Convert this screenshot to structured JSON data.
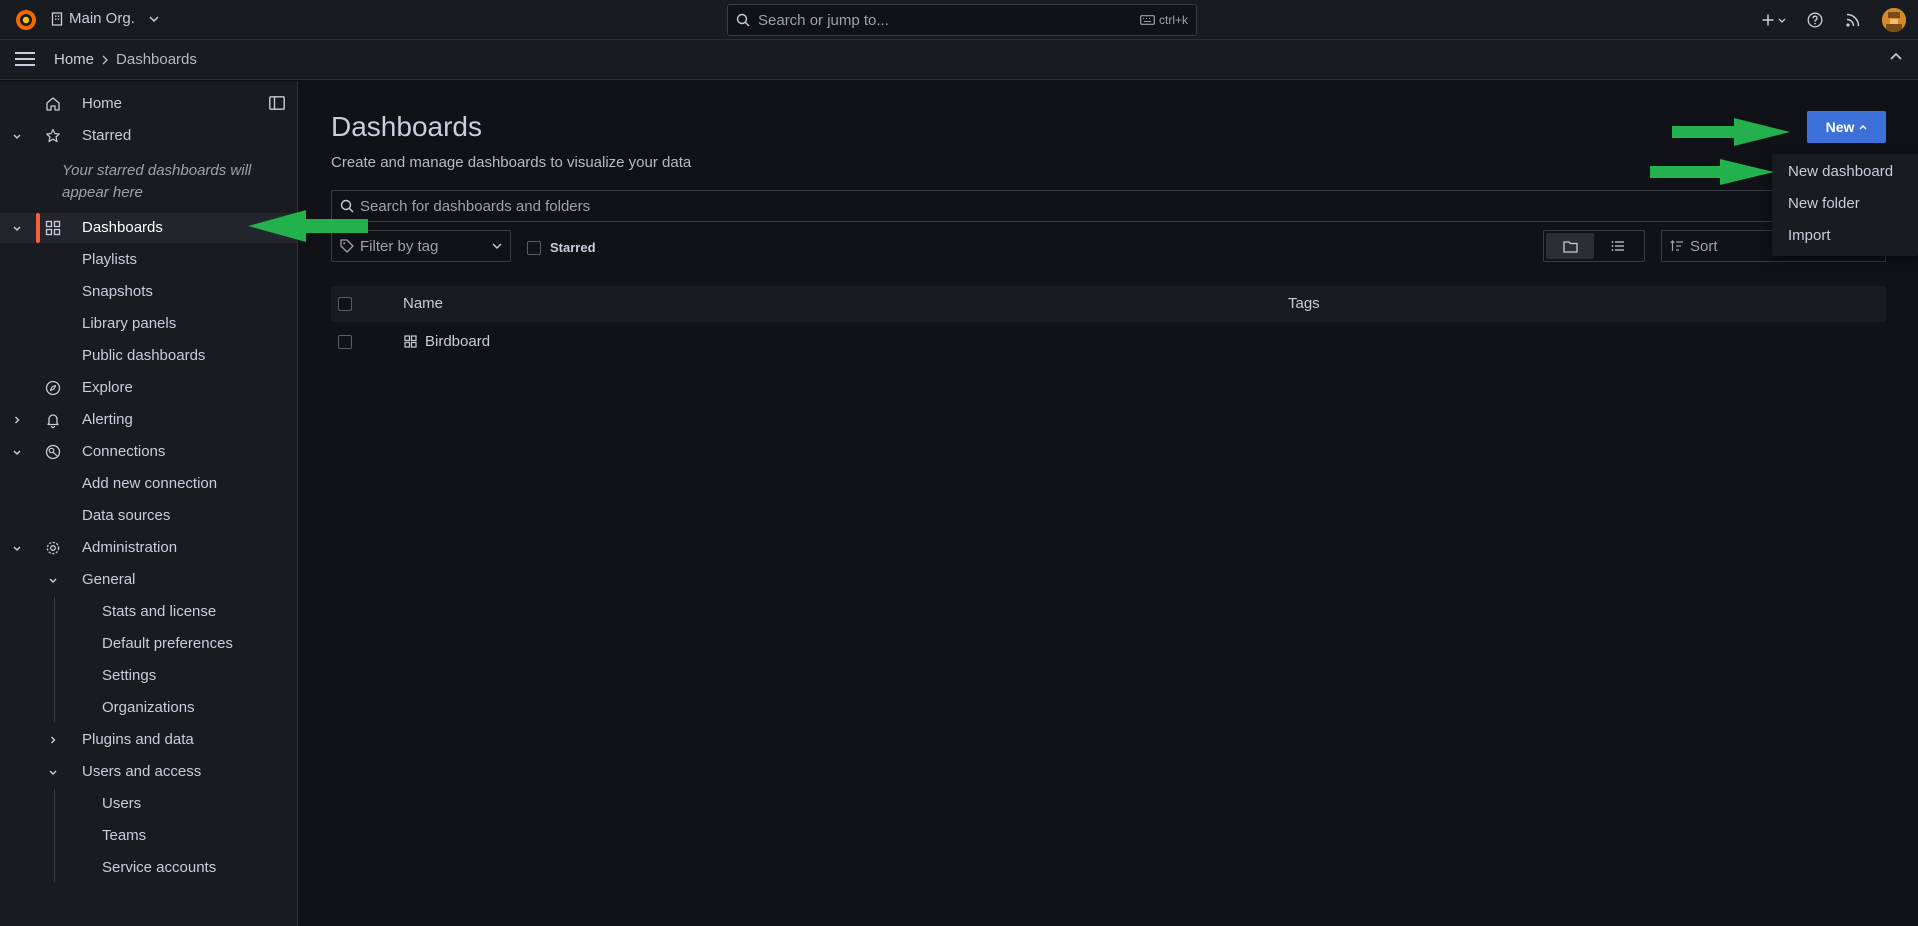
{
  "topbar": {
    "org_name": "Main Org.",
    "search_placeholder": "Search or jump to...",
    "search_shortcut": "ctrl+k"
  },
  "breadcrumb": {
    "home": "Home",
    "current": "Dashboards"
  },
  "sidebar": {
    "home": "Home",
    "starred": "Starred",
    "starred_empty": "Your starred dashboards will appear here",
    "dashboards": "Dashboards",
    "playlists": "Playlists",
    "snapshots": "Snapshots",
    "library_panels": "Library panels",
    "public_dashboards": "Public dashboards",
    "explore": "Explore",
    "alerting": "Alerting",
    "connections": "Connections",
    "add_new_connection": "Add new connection",
    "data_sources": "Data sources",
    "administration": "Administration",
    "general": "General",
    "stats_and_license": "Stats and license",
    "default_preferences": "Default preferences",
    "settings": "Settings",
    "organizations": "Organizations",
    "plugins_and_data": "Plugins and data",
    "users_and_access": "Users and access",
    "users": "Users",
    "teams": "Teams",
    "service_accounts": "Service accounts"
  },
  "main": {
    "title": "Dashboards",
    "subtitle": "Create and manage dashboards to visualize your data",
    "new_button": "New",
    "search_placeholder": "Search for dashboards and folders",
    "filter_tag_placeholder": "Filter by tag",
    "starred_label": "Starred",
    "sort_placeholder": "Sort",
    "columns": {
      "name": "Name",
      "tags": "Tags"
    },
    "rows": [
      {
        "name": "Birdboard"
      }
    ]
  },
  "new_menu": {
    "new_dashboard": "New dashboard",
    "new_folder": "New folder",
    "import": "Import"
  },
  "colors": {
    "accent_blue": "#3d71d9",
    "active_marker": "#f55f3e",
    "annotation_arrow": "#22b14c"
  }
}
